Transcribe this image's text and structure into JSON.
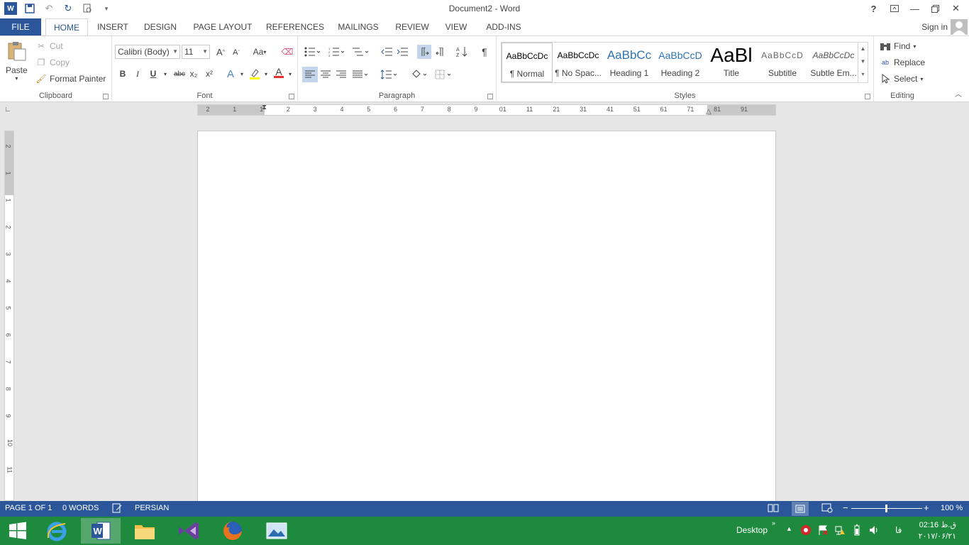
{
  "window": {
    "title": "Document2 - Word",
    "qat": [
      "word-icon",
      "save-icon",
      "undo-icon",
      "redo-icon",
      "print-preview-icon",
      "customize-qat-icon"
    ],
    "help": "?",
    "controls": [
      "ribbon-display-icon",
      "minimize-icon",
      "restore-icon",
      "close-icon"
    ]
  },
  "tabs": [
    "FILE",
    "HOME",
    "INSERT",
    "DESIGN",
    "PAGE LAYOUT",
    "REFERENCES",
    "MAILINGS",
    "REVIEW",
    "VIEW",
    "ADD-INS"
  ],
  "active_tab": "HOME",
  "signin": "Sign in",
  "clipboard": {
    "paste": "Paste",
    "cut": "Cut",
    "copy": "Copy",
    "format_painter": "Format Painter",
    "label": "Clipboard"
  },
  "font": {
    "family": "Calibri (Body)",
    "size": "11",
    "grow": "A",
    "shrink": "A",
    "case": "Aa",
    "bold": "B",
    "italic": "I",
    "underline": "U",
    "strike": "abc",
    "subscript": "x₂",
    "superscript": "x²",
    "text_effects": "A",
    "font_color": "A",
    "label": "Font"
  },
  "paragraph": {
    "label": "Paragraph",
    "show_marks": "¶"
  },
  "styles": {
    "label": "Styles",
    "items": [
      {
        "preview": "AaBbCcDc",
        "name": "¶ Normal"
      },
      {
        "preview": "AaBbCcDc",
        "name": "¶ No Spac..."
      },
      {
        "preview": "AaBbCc",
        "name": "Heading 1"
      },
      {
        "preview": "AaBbCcD",
        "name": "Heading 2"
      },
      {
        "preview": "AaBl",
        "name": "Title"
      },
      {
        "preview": "AaBbCcD",
        "name": "Subtitle"
      },
      {
        "preview": "AaBbCcDc",
        "name": "Subtle Em..."
      }
    ]
  },
  "editing": {
    "find": "Find",
    "replace": "Replace",
    "select": "Select",
    "label": "Editing"
  },
  "ruler": {
    "h_numbers": [
      "2",
      "1",
      "1",
      "2",
      "3",
      "4",
      "5",
      "6",
      "7",
      "8",
      "9",
      "01",
      "11",
      "21",
      "31",
      "41",
      "51",
      "61",
      "71",
      "81",
      "91"
    ],
    "v_numbers": [
      "2",
      "1",
      "1",
      "2",
      "3",
      "4",
      "5",
      "6",
      "7",
      "8",
      "9",
      "10",
      "11"
    ]
  },
  "status": {
    "page": "PAGE 1 OF 1",
    "words": "0 WORDS",
    "language": "PERSIAN",
    "zoom": "100 %",
    "zoom_minus": "−",
    "zoom_plus": "+"
  },
  "taskbar": {
    "desktop": "Desktop",
    "lang": "فا",
    "time": "02:16 ق.ظ",
    "date": "۲۰۱۷/۰۶/۲۱"
  }
}
